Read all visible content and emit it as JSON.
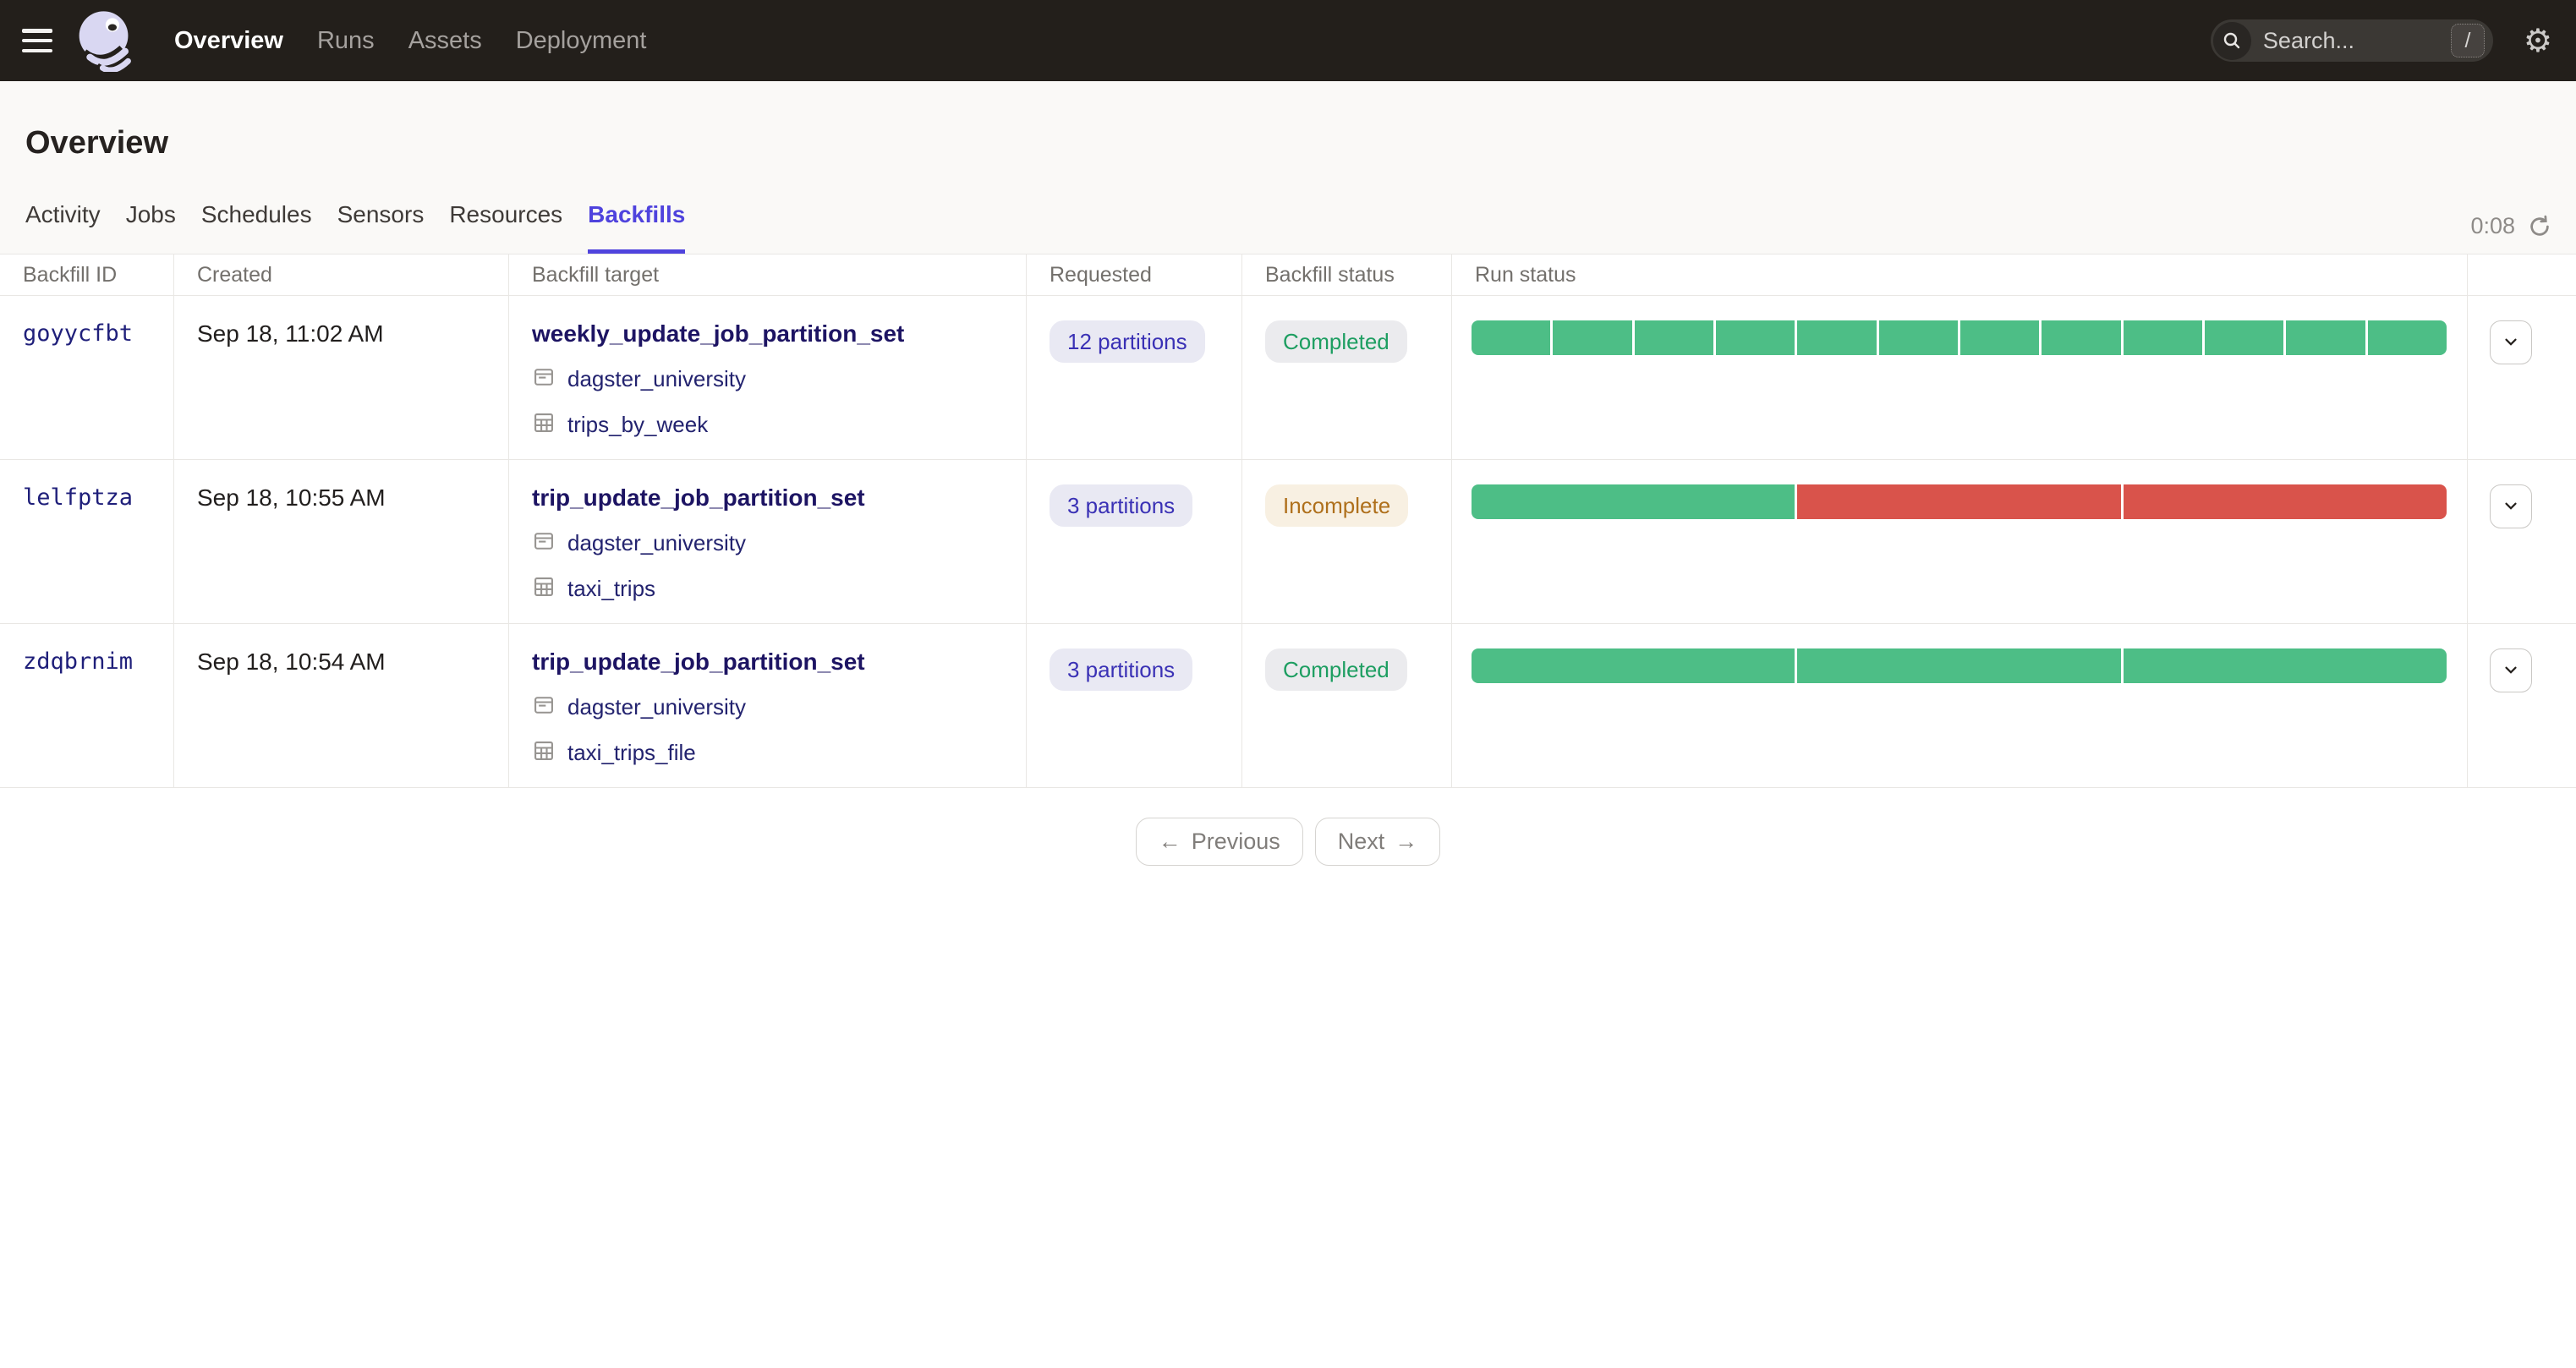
{
  "topbar": {
    "nav_items": [
      {
        "label": "Overview",
        "active": true
      },
      {
        "label": "Runs",
        "active": false
      },
      {
        "label": "Assets",
        "active": false
      },
      {
        "label": "Deployment",
        "active": false
      }
    ],
    "search_placeholder": "Search...",
    "search_shortcut": "/"
  },
  "icons": {
    "gear": "⚙",
    "arrow_left": "←",
    "arrow_right": "→"
  },
  "page": {
    "title": "Overview"
  },
  "tabs": {
    "items": [
      {
        "label": "Activity"
      },
      {
        "label": "Jobs"
      },
      {
        "label": "Schedules"
      },
      {
        "label": "Sensors"
      },
      {
        "label": "Resources"
      },
      {
        "label": "Backfills"
      }
    ],
    "active_tab": "Backfills",
    "refresh_timer": "0:08"
  },
  "table": {
    "columns": [
      "Backfill ID",
      "Created",
      "Backfill target",
      "Requested",
      "Backfill status",
      "Run status"
    ],
    "rows": [
      {
        "id": "goyycfbt",
        "created": "Sep 18, 11:02 AM",
        "target": "weekly_update_job_partition_set",
        "code_location": "dagster_university",
        "asset": "trips_by_week",
        "requested": "12 partitions",
        "status": "Completed",
        "status_type": "completed",
        "run_segments": [
          {
            "status": "success",
            "count": 12
          }
        ]
      },
      {
        "id": "lelfptza",
        "created": "Sep 18, 10:55 AM",
        "target": "trip_update_job_partition_set",
        "code_location": "dagster_university",
        "asset": "taxi_trips",
        "requested": "3 partitions",
        "status": "Incomplete",
        "status_type": "incomplete",
        "run_segments": [
          {
            "status": "success",
            "count": 1
          },
          {
            "status": "failure",
            "count": 2
          }
        ]
      },
      {
        "id": "zdqbrnim",
        "created": "Sep 18, 10:54 AM",
        "target": "trip_update_job_partition_set",
        "code_location": "dagster_university",
        "asset": "taxi_trips_file",
        "requested": "3 partitions",
        "status": "Completed",
        "status_type": "completed",
        "run_segments": [
          {
            "status": "success",
            "count": 3
          }
        ]
      }
    ],
    "run_status_colors": {
      "success": "#4DBE86",
      "failure": "#D9534B"
    }
  },
  "pagination": {
    "previous_label": "Previous",
    "next_label": "Next"
  },
  "colors": {
    "topbar_bg": "#231F1B",
    "accent": "#4F43DD",
    "page_bg": "#FAF9F7",
    "success": "#4DBE86",
    "failure": "#D9534B"
  }
}
